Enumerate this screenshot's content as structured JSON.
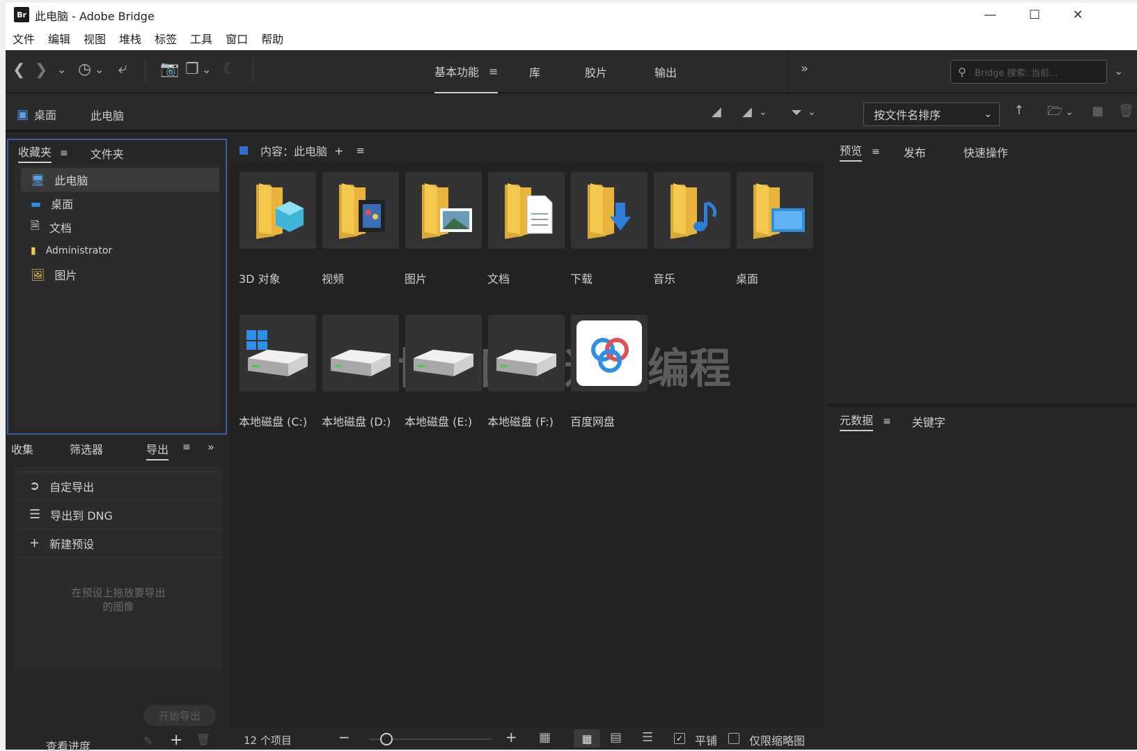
{
  "window": {
    "title": "此电脑 - Adobe Bridge",
    "logo": "Br"
  },
  "menu": [
    "文件",
    "编辑",
    "视图",
    "堆栈",
    "标签",
    "工具",
    "窗口",
    "帮助"
  ],
  "workspaces": {
    "essentials": "基本功能",
    "library": "库",
    "filmstrip": "胶片",
    "output": "输出"
  },
  "search": {
    "placeholder": "Bridge 搜索: 当前..."
  },
  "pathbar": {
    "desktop": "桌面",
    "this_pc": "此电脑"
  },
  "sort": {
    "label": "按文件名排序"
  },
  "favorites": {
    "tabs": {
      "favorites": "收藏夹",
      "folders": "文件夹"
    },
    "items": [
      {
        "label": "此电脑",
        "icon": "computer-icon"
      },
      {
        "label": "桌面",
        "icon": "desktop-icon"
      },
      {
        "label": "文档",
        "icon": "document-icon"
      },
      {
        "label": "Administrator",
        "icon": "user-folder-icon"
      },
      {
        "label": "图片",
        "icon": "pictures-icon"
      }
    ]
  },
  "export": {
    "tabs": {
      "collections": "收集",
      "filter": "筛选器",
      "export": "导出"
    },
    "items": [
      {
        "label": "自定导出",
        "icon": "export-icon"
      },
      {
        "label": "导出到 DNG",
        "icon": "list-icon"
      },
      {
        "label": "新建预设",
        "icon": "plus-icon"
      }
    ],
    "hint_line1": "在预设上拖放要导出",
    "hint_line2": "的图像",
    "start_button": "开始导出",
    "progress": "查看进度"
  },
  "content": {
    "header": "内容：此电脑",
    "folders": [
      {
        "label": "3D 对象",
        "overlay": "3d",
        "accent": "#3fb3d8"
      },
      {
        "label": "视频",
        "overlay": "video",
        "accent": "#3b6fb5"
      },
      {
        "label": "图片",
        "overlay": "picture",
        "accent": "#6a9bb8"
      },
      {
        "label": "文档",
        "overlay": "doc",
        "accent": "#ffffff"
      },
      {
        "label": "下载",
        "overlay": "download",
        "accent": "#2e7fd9"
      },
      {
        "label": "音乐",
        "overlay": "music",
        "accent": "#2e7fd9"
      },
      {
        "label": "桌面",
        "overlay": "desktop",
        "accent": "#2e8fe0"
      }
    ],
    "drives": [
      {
        "label": "本地磁盘 (C:)",
        "windows": true
      },
      {
        "label": "本地磁盘 (D:)",
        "windows": false
      },
      {
        "label": "本地磁盘 (E:)",
        "windows": false
      },
      {
        "label": "本地磁盘 (F:)",
        "windows": false
      }
    ],
    "cloud": {
      "label": "百度网盘"
    },
    "watermark": "博客园@逆向编程",
    "status": {
      "count": "12 个项目",
      "tile_label": "平铺",
      "thumb_only": "仅限缩略图",
      "zoom": 0.1
    }
  },
  "preview": {
    "tabs": {
      "preview": "预览",
      "publish": "发布",
      "quick": "快速操作"
    }
  },
  "metadata": {
    "tabs": {
      "metadata": "元数据",
      "keywords": "关键字"
    }
  },
  "colors": {
    "background": "#262626",
    "accent_blue": "#2f6fd0",
    "folder_yellow": "#f2c94c"
  }
}
